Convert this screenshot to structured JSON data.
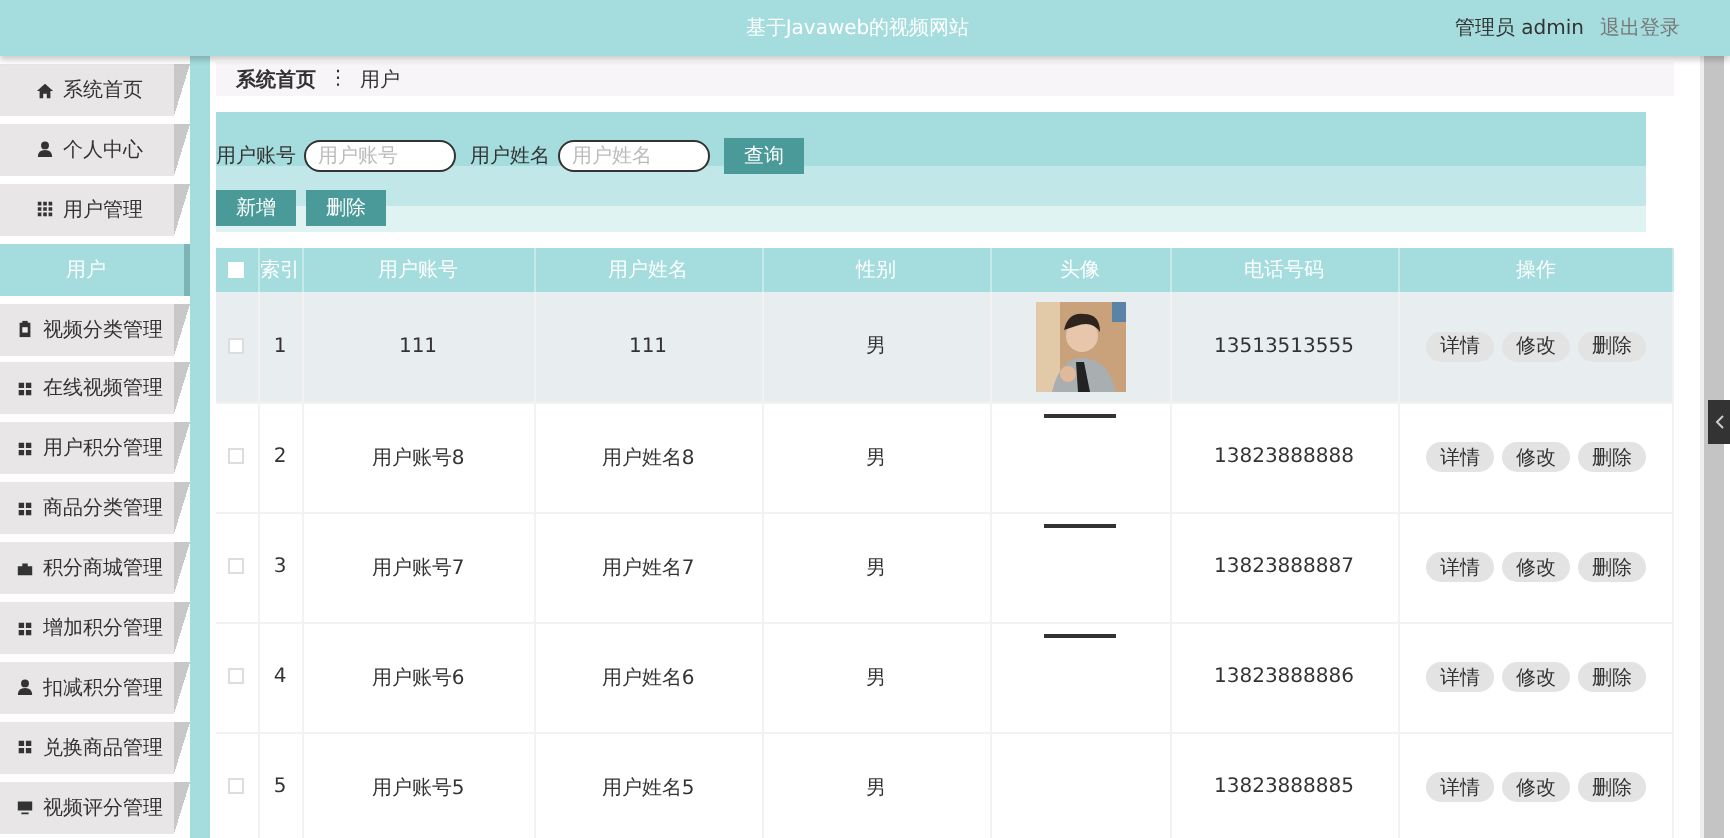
{
  "header": {
    "title": "基于Javaweb的视频网站",
    "user": "管理员 admin",
    "logout": "退出登录"
  },
  "sidebar": {
    "items": [
      {
        "label": "系统首页",
        "selected": false
      },
      {
        "label": "个人中心",
        "selected": false
      },
      {
        "label": "用户管理",
        "selected": false
      },
      {
        "label": "用户",
        "selected": true
      },
      {
        "label": "视频分类管理",
        "selected": false
      },
      {
        "label": "在线视频管理",
        "selected": false
      },
      {
        "label": "用户积分管理",
        "selected": false
      },
      {
        "label": "商品分类管理",
        "selected": false
      },
      {
        "label": "积分商城管理",
        "selected": false
      },
      {
        "label": "增加积分管理",
        "selected": false
      },
      {
        "label": "扣减积分管理",
        "selected": false
      },
      {
        "label": "兑换商品管理",
        "selected": false
      },
      {
        "label": "视频评分管理",
        "selected": false
      }
    ]
  },
  "breadcrumb": {
    "home": "系统首页",
    "separator": "⋮",
    "current": "用户"
  },
  "search": {
    "fields": [
      {
        "label": "用户账号",
        "placeholder": "用户账号"
      },
      {
        "label": "用户姓名",
        "placeholder": "用户姓名"
      }
    ],
    "button": "查询"
  },
  "actions": [
    "新增",
    "删除"
  ],
  "table": {
    "header_checked": false,
    "columns": [
      "索引",
      "用户账号",
      "用户姓名",
      "性别",
      "头像",
      "电话号码",
      "操作"
    ],
    "rows": [
      {
        "checked": false,
        "highlighted": true,
        "index": "1",
        "account": "111",
        "name": "111",
        "gender": "男",
        "phone": "13513513555",
        "buttons": [
          "详情",
          "修改",
          "删除"
        ]
      },
      {
        "checked": false,
        "highlighted": false,
        "index": "2",
        "account": "用户账号8",
        "name": "用户姓名8",
        "gender": "男",
        "avatar": {
          "kind": "strip"
        },
        "phone": "13823888888",
        "buttons": [
          "详情",
          "修改",
          "删除"
        ]
      },
      {
        "checked": false,
        "highlighted": false,
        "index": "3",
        "account": "用户账号7",
        "name": "用户姓名7",
        "gender": "男",
        "avatar": {
          "kind": "strip"
        },
        "phone": "13823888887",
        "buttons": [
          "详情",
          "修改",
          "删除"
        ]
      },
      {
        "checked": false,
        "highlighted": false,
        "index": "4",
        "account": "用户账号6",
        "name": "用户姓名6",
        "gender": "男",
        "avatar": {
          "kind": "strip"
        },
        "phone": "13823888886",
        "buttons": [
          "详情",
          "修改",
          "删除"
        ]
      },
      {
        "checked": false,
        "highlighted": false,
        "index": "5",
        "account": "用户账号5",
        "name": "用户姓名5",
        "gender": "男",
        "phone": "13823888885",
        "buttons": [
          "详情",
          "修改",
          "删除"
        ]
      }
    ]
  }
}
